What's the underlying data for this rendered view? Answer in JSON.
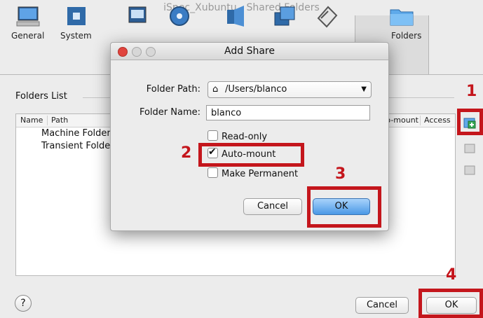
{
  "window": {
    "title": "iSpec_Xubuntu - Shared Folders"
  },
  "toolbar": {
    "items": [
      {
        "label": "General",
        "icon": "monitor-icon"
      },
      {
        "label": "System",
        "icon": "chip-icon"
      },
      {
        "label": "",
        "icon": "display-icon"
      },
      {
        "label": "",
        "icon": "disk-icon"
      },
      {
        "label": "",
        "icon": "audio-icon"
      },
      {
        "label": "",
        "icon": "network-icon"
      },
      {
        "label": "",
        "icon": "usb-icon"
      },
      {
        "label": "Folders",
        "icon": "folder-icon"
      }
    ]
  },
  "folders": {
    "title": "Folders List",
    "columns": [
      "Name",
      "Path",
      "Auto-mount",
      "Access"
    ],
    "rows": [
      "Machine Folders",
      "Transient Folders"
    ]
  },
  "dialog": {
    "title": "Add Share",
    "folder_path_label": "Folder Path:",
    "folder_path_value": "/Users/blanco",
    "folder_name_label": "Folder Name:",
    "folder_name_value": "blanco",
    "readonly_label": "Read-only",
    "readonly_checked": false,
    "automount_label": "Auto-mount",
    "automount_checked": true,
    "permanent_label": "Make Permanent",
    "permanent_checked": false,
    "cancel_label": "Cancel",
    "ok_label": "OK"
  },
  "footer": {
    "help_label": "?",
    "cancel_label": "Cancel",
    "ok_label": "OK"
  },
  "annotations": [
    "1",
    "2",
    "3",
    "4"
  ],
  "colors": {
    "annotation": "#c4161c",
    "accent": "#3b8de0"
  }
}
